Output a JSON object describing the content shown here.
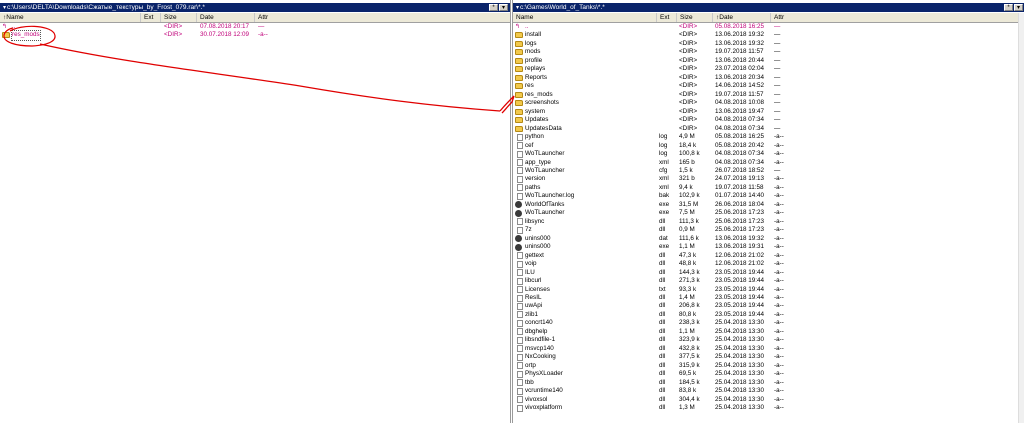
{
  "left": {
    "path": "c:\\Users\\DELTA\\Downloads\\Сжатые_текстуры_by_Frost_079.rar\\*.*",
    "buttons": [
      "*",
      "▾"
    ],
    "columns": {
      "name": "Name",
      "ext": "Ext",
      "size": "Size",
      "date": "Date",
      "attr": "Attr"
    },
    "sort_column": "Name",
    "rows": [
      {
        "name": "..",
        "ext": "",
        "size": "<DIR>",
        "date": "07.08.2018 20:17",
        "attr": "—",
        "type": "up"
      },
      {
        "name": "res_mods",
        "ext": "",
        "size": "<DIR>",
        "date": "30.07.2018 12:09",
        "attr": "-a--",
        "type": "dir",
        "selected": true
      }
    ]
  },
  "right": {
    "path": "c:\\Games\\World_of_Tanks\\*.*",
    "buttons": [
      "*",
      "▾"
    ],
    "columns": {
      "name": "Name",
      "ext": "Ext",
      "size": "Size",
      "date": "Date",
      "attr": "Attr"
    },
    "sort_column": "Date",
    "rows": [
      {
        "name": "..",
        "ext": "",
        "size": "<DIR>",
        "date": "05.08.2018 16:25",
        "attr": "—",
        "type": "up"
      },
      {
        "name": "install",
        "ext": "",
        "size": "<DIR>",
        "date": "13.06.2018 19:32",
        "attr": "—",
        "type": "dir"
      },
      {
        "name": "logs",
        "ext": "",
        "size": "<DIR>",
        "date": "13.06.2018 19:32",
        "attr": "—",
        "type": "dir"
      },
      {
        "name": "mods",
        "ext": "",
        "size": "<DIR>",
        "date": "19.07.2018 11:57",
        "attr": "—",
        "type": "dir"
      },
      {
        "name": "profile",
        "ext": "",
        "size": "<DIR>",
        "date": "13.06.2018 20:44",
        "attr": "—",
        "type": "dir"
      },
      {
        "name": "replays",
        "ext": "",
        "size": "<DIR>",
        "date": "23.07.2018 02:04",
        "attr": "—",
        "type": "dir"
      },
      {
        "name": "Reports",
        "ext": "",
        "size": "<DIR>",
        "date": "13.06.2018 20:34",
        "attr": "—",
        "type": "dir"
      },
      {
        "name": "res",
        "ext": "",
        "size": "<DIR>",
        "date": "14.06.2018 14:52",
        "attr": "—",
        "type": "dir"
      },
      {
        "name": "res_mods",
        "ext": "",
        "size": "<DIR>",
        "date": "19.07.2018 11:57",
        "attr": "—",
        "type": "dir"
      },
      {
        "name": "screenshots",
        "ext": "",
        "size": "<DIR>",
        "date": "04.08.2018 10:08",
        "attr": "—",
        "type": "dir"
      },
      {
        "name": "system",
        "ext": "",
        "size": "<DIR>",
        "date": "13.06.2018 19:47",
        "attr": "—",
        "type": "dir"
      },
      {
        "name": "Updates",
        "ext": "",
        "size": "<DIR>",
        "date": "04.08.2018 07:34",
        "attr": "—",
        "type": "dir"
      },
      {
        "name": "UpdatesData",
        "ext": "",
        "size": "<DIR>",
        "date": "04.08.2018 07:34",
        "attr": "—",
        "type": "dir"
      },
      {
        "name": "python",
        "ext": "log",
        "size": "4,9 M",
        "date": "05.08.2018 16:25",
        "attr": "-a--",
        "type": "file"
      },
      {
        "name": "cef",
        "ext": "log",
        "size": "18,4 k",
        "date": "05.08.2018 20:42",
        "attr": "-a--",
        "type": "file"
      },
      {
        "name": "WoTLauncher",
        "ext": "log",
        "size": "100,8 k",
        "date": "04.08.2018 07:34",
        "attr": "-a--",
        "type": "file"
      },
      {
        "name": "app_type",
        "ext": "xml",
        "size": "165 b",
        "date": "04.08.2018 07:34",
        "attr": "-a--",
        "type": "file"
      },
      {
        "name": "WoTLauncher",
        "ext": "cfg",
        "size": "1,5 k",
        "date": "26.07.2018 18:52",
        "attr": "—",
        "type": "file"
      },
      {
        "name": "version",
        "ext": "xml",
        "size": "321 b",
        "date": "24.07.2018 19:13",
        "attr": "-a--",
        "type": "file"
      },
      {
        "name": "paths",
        "ext": "xml",
        "size": "9,4 k",
        "date": "19.07.2018 11:58",
        "attr": "-a--",
        "type": "file"
      },
      {
        "name": "WoTLauncher.log",
        "ext": "bak",
        "size": "102,9 k",
        "date": "01.07.2018 14:40",
        "attr": "-a--",
        "type": "file"
      },
      {
        "name": "WorldOfTanks",
        "ext": "exe",
        "size": "31,5 M",
        "date": "26.06.2018 18:04",
        "attr": "-a--",
        "type": "exe"
      },
      {
        "name": "WoTLauncher",
        "ext": "exe",
        "size": "7,5 M",
        "date": "25.06.2018 17:23",
        "attr": "-a--",
        "type": "exe"
      },
      {
        "name": "libsync",
        "ext": "dll",
        "size": "111,3 k",
        "date": "25.06.2018 17:23",
        "attr": "-a--",
        "type": "file"
      },
      {
        "name": "7z",
        "ext": "dll",
        "size": "0,9 M",
        "date": "25.06.2018 17:23",
        "attr": "-a--",
        "type": "file"
      },
      {
        "name": "unins000",
        "ext": "dat",
        "size": "111,6 k",
        "date": "13.06.2018 19:32",
        "attr": "-a--",
        "type": "exe"
      },
      {
        "name": "unins000",
        "ext": "exe",
        "size": "1,1 M",
        "date": "13.06.2018 19:31",
        "attr": "-a--",
        "type": "exe"
      },
      {
        "name": "gettext",
        "ext": "dll",
        "size": "47,3 k",
        "date": "12.06.2018 21:02",
        "attr": "-a--",
        "type": "file"
      },
      {
        "name": "voip",
        "ext": "dll",
        "size": "48,8 k",
        "date": "12.06.2018 21:02",
        "attr": "-a--",
        "type": "file"
      },
      {
        "name": "ILU",
        "ext": "dll",
        "size": "144,3 k",
        "date": "23.05.2018 19:44",
        "attr": "-a--",
        "type": "file"
      },
      {
        "name": "libcurl",
        "ext": "dll",
        "size": "271,3 k",
        "date": "23.05.2018 19:44",
        "attr": "-a--",
        "type": "file"
      },
      {
        "name": "Licenses",
        "ext": "txt",
        "size": "93,3 k",
        "date": "23.05.2018 19:44",
        "attr": "-a--",
        "type": "file"
      },
      {
        "name": "ResIL",
        "ext": "dll",
        "size": "1,4 M",
        "date": "23.05.2018 19:44",
        "attr": "-a--",
        "type": "file"
      },
      {
        "name": "uwApi",
        "ext": "dll",
        "size": "206,8 k",
        "date": "23.05.2018 19:44",
        "attr": "-a--",
        "type": "file"
      },
      {
        "name": "zlib1",
        "ext": "dll",
        "size": "80,8 k",
        "date": "23.05.2018 19:44",
        "attr": "-a--",
        "type": "file"
      },
      {
        "name": "concrt140",
        "ext": "dll",
        "size": "238,3 k",
        "date": "25.04.2018 13:30",
        "attr": "-a--",
        "type": "file"
      },
      {
        "name": "dbghelp",
        "ext": "dll",
        "size": "1,1 M",
        "date": "25.04.2018 13:30",
        "attr": "-a--",
        "type": "file"
      },
      {
        "name": "libsndfile-1",
        "ext": "dll",
        "size": "323,9 k",
        "date": "25.04.2018 13:30",
        "attr": "-a--",
        "type": "file"
      },
      {
        "name": "msvcp140",
        "ext": "dll",
        "size": "432,8 k",
        "date": "25.04.2018 13:30",
        "attr": "-a--",
        "type": "file"
      },
      {
        "name": "NxCooking",
        "ext": "dll",
        "size": "377,5 k",
        "date": "25.04.2018 13:30",
        "attr": "-a--",
        "type": "file"
      },
      {
        "name": "ortp",
        "ext": "dll",
        "size": "315,9 k",
        "date": "25.04.2018 13:30",
        "attr": "-a--",
        "type": "file"
      },
      {
        "name": "PhysXLoader",
        "ext": "dll",
        "size": "69,5 k",
        "date": "25.04.2018 13:30",
        "attr": "-a--",
        "type": "file"
      },
      {
        "name": "tbb",
        "ext": "dll",
        "size": "184,5 k",
        "date": "25.04.2018 13:30",
        "attr": "-a--",
        "type": "file"
      },
      {
        "name": "vcruntime140",
        "ext": "dll",
        "size": "83,8 k",
        "date": "25.04.2018 13:30",
        "attr": "-a--",
        "type": "file"
      },
      {
        "name": "vivoxsol",
        "ext": "dll",
        "size": "304,4 k",
        "date": "25.04.2018 13:30",
        "attr": "-a--",
        "type": "file"
      },
      {
        "name": "vivoxplatform",
        "ext": "dll",
        "size": "1,3 M",
        "date": "25.04.2018 13:30",
        "attr": "-a--",
        "type": "file"
      }
    ]
  },
  "colors": {
    "pathbar_bg": "#0a246a",
    "highlight_text": "#c0007a",
    "annotation": "#e00000"
  }
}
